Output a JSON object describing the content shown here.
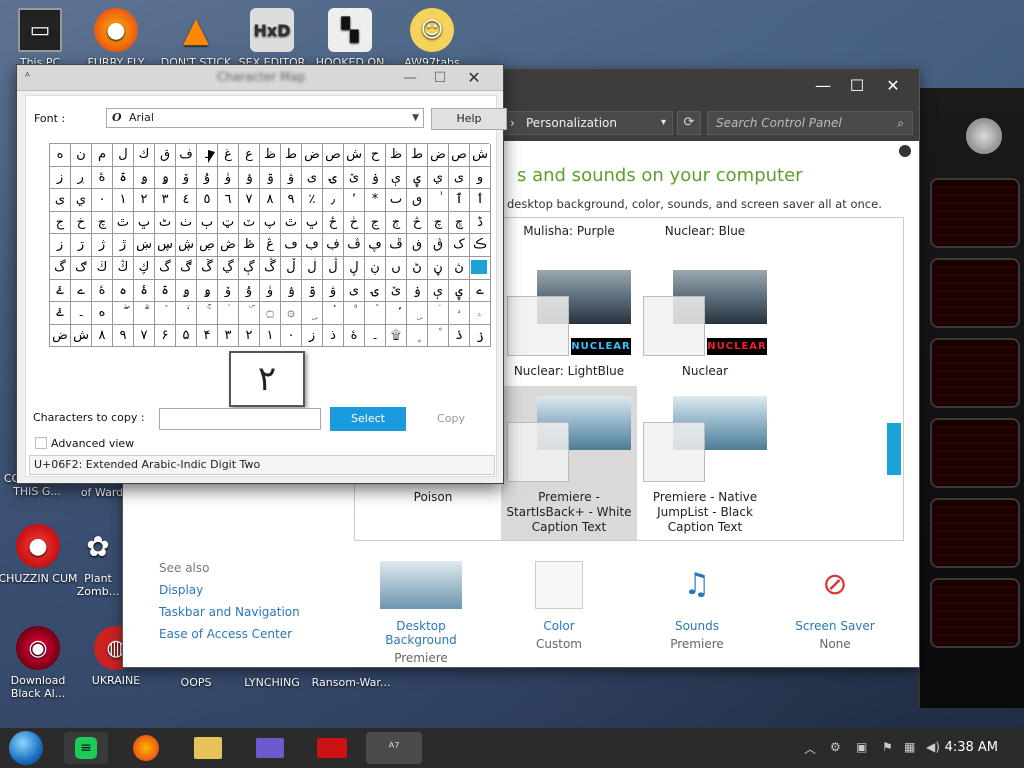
{
  "desktop": {
    "top_icons": [
      "This PC",
      "FURRY FLY",
      "DON'T STICK",
      "SEX EDITOR",
      "HOOKED ON",
      "AW97tabs"
    ],
    "left_icons": [
      {
        "label": "COWS HATE THIS G...",
        "partial": true
      },
      {
        "label": "of Ward",
        "partial": true
      },
      {
        "label": "CHUZZIN CUM"
      },
      {
        "label": "Plant Zomb..."
      },
      {
        "label": "Download Black Al..."
      },
      {
        "label": "UKRAINE"
      },
      {
        "label": "OOPS"
      },
      {
        "label": "LYNCHING"
      },
      {
        "label": "Ransom-War..."
      }
    ]
  },
  "control_panel": {
    "breadcrumb": "Personalization",
    "search_placeholder": "Search Control Panel",
    "heading": "s and sounds on your computer",
    "subheading": "desktop background, color, sounds, and screen saver all at once.",
    "themes": [
      {
        "name": "Mulisha: Purple"
      },
      {
        "name": "Nuclear: Blue"
      },
      {
        "name": "Nuclear: LightBlue",
        "tag": "NUCLEAR"
      },
      {
        "name": "Nuclear",
        "tag": "NUCLEAR"
      },
      {
        "name": "Poison"
      },
      {
        "name": "Premiere - StartIsBack+ - White Caption Text",
        "selected": true
      },
      {
        "name": "Premiere - Native JumpList - Black Caption Text"
      }
    ],
    "see_also": {
      "heading": "See also",
      "links": [
        "Display",
        "Taskbar and Navigation",
        "Ease of Access Center"
      ]
    },
    "bottom": [
      {
        "title": "Desktop Background",
        "value": "Premiere"
      },
      {
        "title": "Color",
        "value": "Custom"
      },
      {
        "title": "Sounds",
        "value": "Premiere"
      },
      {
        "title": "Screen Saver",
        "value": "None"
      }
    ]
  },
  "charmap": {
    "title": "Character Map",
    "font_label": "Font :",
    "font_value": "Arial",
    "help": "Help",
    "chars_to_copy_label": "Characters to copy :",
    "chars_to_copy_value": "",
    "select": "Select",
    "copy": "Copy",
    "advanced": "Advanced view",
    "status": "U+06F2: Extended Arabic-Indic Digit Two",
    "zoom_char": "۲",
    "grid": [
      "ه",
      "ن",
      "م",
      "ل",
      "ك",
      "ق",
      "ف",
      "ـ",
      "غ",
      "ع",
      "ظ",
      "ط",
      "ض",
      "ص",
      "ش",
      "ح",
      "ظ",
      "ط",
      "ض",
      "ص",
      "ش",
      "ز",
      "ڔ",
      "ۀ",
      "ۃ",
      "ۄ",
      "ۅ",
      "ۆ",
      "ۇ",
      "ۈ",
      "ۉ",
      "ۊ",
      "ۋ",
      "ی",
      "ۍ",
      "ێ",
      "ۏ",
      "ې",
      "ۑ",
      "ي",
      "ى",
      "و",
      "ى",
      "ي",
      "٠",
      "١",
      "٢",
      "٣",
      "٤",
      "٥",
      "٦",
      "٧",
      "٨",
      "٩",
      "٪",
      "٫",
      "٬",
      "*",
      "ٮ",
      "ٯ",
      "ٰ",
      "ٱ",
      "ٲ",
      "ج",
      "خ",
      "چ",
      "ٿ",
      "ڀ",
      "ٹ",
      "ٺ",
      "ٻ",
      "ټ",
      "ٽ",
      "پ",
      "ٿ",
      "ڀ",
      "ځ",
      "ڂ",
      "ڃ",
      "ڄ",
      "څ",
      "چ",
      "ڇ",
      "ڈ",
      "ز",
      "ڗ",
      "ژ",
      "ڙ",
      "ښ",
      "ڛ",
      "ڜ",
      "ڝ",
      "ڞ",
      "ڟ",
      "ڠ",
      "ڡ",
      "ڢ",
      "ڣ",
      "ڤ",
      "ڥ",
      "ڦ",
      "ڧ",
      "ڨ",
      "ک",
      "ڪ",
      "گ",
      "ګ",
      "ڬ",
      "ڭ",
      "ڮ",
      "گ",
      "ڰ",
      "ڱ",
      "ڲ",
      "ڳ",
      "ڴ",
      "ڵ",
      "ڶ",
      "ڷ",
      "ڸ",
      "ڹ",
      "ں",
      "ڻ",
      "ڼ",
      "ڽ",
      "ھ",
      "ۓ",
      "ے",
      "ۀ",
      "ہ",
      "ۂ",
      "ۃ",
      "ۄ",
      "ۅ",
      "ۆ",
      "ۇ",
      "ۈ",
      "ۉ",
      "ۊ",
      "ۋ",
      "ی",
      "ۍ",
      "ێ",
      "ۏ",
      "ې",
      "ۑ",
      "ے",
      "ۓ",
      "۔",
      "ە",
      "ۖ",
      "ۗ",
      "ۘ",
      "ۙ",
      "ۚ",
      "ۛ",
      "ۜ",
      "۝",
      "۞",
      "ۣ",
      "۟",
      "۠",
      "ۡ",
      "ۢ",
      "ۣ",
      "ۤ",
      "ۥ",
      "ۦ",
      "ض",
      "ش",
      "۸",
      "۹",
      "۷",
      "۶",
      "۵",
      "۴",
      "۳",
      "۲",
      "۱",
      "۰",
      "ز",
      "ذ",
      "ۀ",
      "۔",
      "۩",
      "۪",
      "۫",
      "ۮ",
      "ۯ"
    ]
  },
  "taskbar": {
    "time": "4:38 AM"
  }
}
